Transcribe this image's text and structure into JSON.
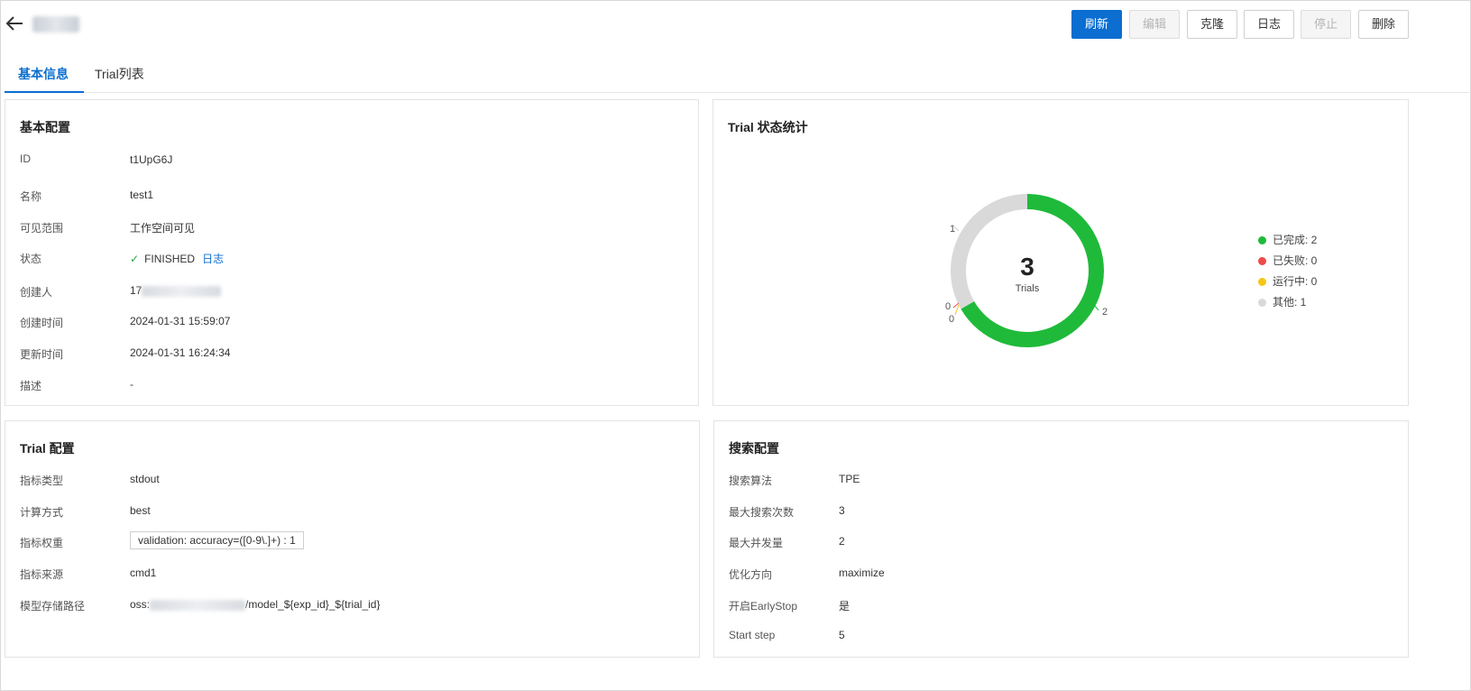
{
  "header": {
    "buttons": {
      "refresh": "刷新",
      "edit": "编辑",
      "clone": "克隆",
      "log": "日志",
      "stop": "停止",
      "delete": "删除"
    }
  },
  "tabs": [
    {
      "label": "基本信息",
      "active": true
    },
    {
      "label": "Trial列表",
      "active": false
    }
  ],
  "basic_config": {
    "title": "基本配置",
    "id_label": "ID",
    "id_value": "t1UpG6J",
    "name_label": "名称",
    "name_value": "test1",
    "visibility_label": "可见范围",
    "visibility_value": "工作空间可见",
    "status_label": "状态",
    "status_value": "FINISHED",
    "status_log_link": "日志",
    "creator_label": "创建人",
    "creator_value_prefix": "17",
    "created_label": "创建时间",
    "created_value": "2024-01-31 15:59:07",
    "updated_label": "更新时间",
    "updated_value": "2024-01-31 16:24:34",
    "desc_label": "描述",
    "desc_value": "-"
  },
  "trial_stats": {
    "title": "Trial 状态统计",
    "center_value": "3",
    "center_label": "Trials"
  },
  "chart_data": {
    "type": "pie",
    "title": "Trial 状态统计",
    "total": 3,
    "slices": [
      {
        "name": "已完成",
        "value": 2,
        "color": "#1fba3a"
      },
      {
        "name": "已失败",
        "value": 0,
        "color": "#f04a4a"
      },
      {
        "name": "运行中",
        "value": 0,
        "color": "#f5c518"
      },
      {
        "name": "其他",
        "value": 1,
        "color": "#d9d9d9"
      }
    ],
    "legend": [
      {
        "label": "已完成: 2"
      },
      {
        "label": "已失败: 0"
      },
      {
        "label": "运行中: 0"
      },
      {
        "label": "其他: 1"
      }
    ],
    "slice_labels": {
      "completed": "2",
      "other": "1",
      "failed": "0",
      "running": "0"
    },
    "legend_position": "right"
  },
  "trial_config": {
    "title": "Trial 配置",
    "metric_type_label": "指标类型",
    "metric_type_value": "stdout",
    "calc_label": "计算方式",
    "calc_value": "best",
    "weight_label": "指标权重",
    "weight_value": "validation: accuracy=([0-9\\.]+) : 1",
    "source_label": "指标来源",
    "source_value": "cmd1",
    "path_label": "模型存储路径",
    "path_prefix": "oss:",
    "path_suffix": "/model_${exp_id}_${trial_id}"
  },
  "search_config": {
    "title": "搜索配置",
    "algo_label": "搜索算法",
    "algo_value": "TPE",
    "max_trials_label": "最大搜索次数",
    "max_trials_value": "3",
    "max_concurrency_label": "最大并发量",
    "max_concurrency_value": "2",
    "direction_label": "优化方向",
    "direction_value": "maximize",
    "earlystop_label": "开启EarlyStop",
    "earlystop_value": "是",
    "start_step_label": "Start step",
    "start_step_value": "5"
  }
}
